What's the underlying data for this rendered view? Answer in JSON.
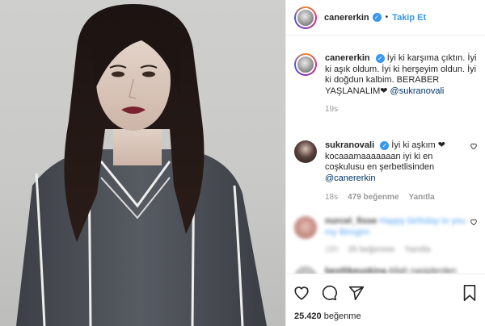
{
  "header": {
    "username": "canererkin",
    "separator": "•",
    "follow_label": "Takip Et"
  },
  "caption": {
    "username": "canererkin",
    "text": "İyi ki karşıma çıktın. İyi ki aşık oldum. İyi ki herşeyim oldun. İyi ki doğdun kalbim. BERABER YAŞLANALIM❤",
    "mention": "@sukranovali",
    "time": "19s"
  },
  "reply": {
    "username": "sukranovali",
    "text": "İyi ki aşkım ❤ kocaaamaaaaaaan iyi ki en coşkulusu en şerbetlisinden",
    "mention": "@canererkin",
    "time": "18s",
    "likes": "479 beğenme",
    "reply_label": "Yanıtla"
  },
  "blurred_comment_1": {
    "username": "nurcel_fisse",
    "text": "Happy birthday to you my Birogim",
    "time": "18h",
    "likes": "25 beğenme",
    "reply_label": "Yanıtla"
  },
  "blurred_comment_2": {
    "username": "bestlikeuskina",
    "text": "Allah nasiplerden"
  },
  "footer": {
    "likes_count": "25.420",
    "likes_label": "beğenme"
  },
  "colors": {
    "link": "#3897f0",
    "mention": "#003569",
    "muted": "#999999"
  }
}
